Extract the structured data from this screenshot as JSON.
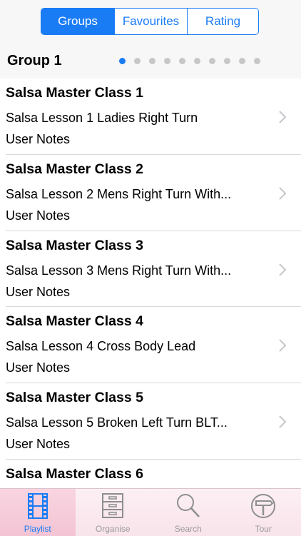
{
  "top_tabs": [
    {
      "label": "Groups",
      "active": true
    },
    {
      "label": "Favourites",
      "active": false
    },
    {
      "label": "Rating",
      "active": false
    }
  ],
  "group": {
    "title": "Group 1",
    "page_count": 10,
    "current_page": 1
  },
  "lessons": [
    {
      "title": "Salsa Master Class 1",
      "subtitle": "Salsa Lesson 1 Ladies Right Turn",
      "notes": "User Notes"
    },
    {
      "title": "Salsa Master Class 2",
      "subtitle": "Salsa Lesson 2 Mens Right Turn With...",
      "notes": "User Notes"
    },
    {
      "title": "Salsa Master Class 3",
      "subtitle": "Salsa Lesson 3 Mens Right Turn With...",
      "notes": "User Notes"
    },
    {
      "title": "Salsa Master Class 4",
      "subtitle": "Salsa Lesson 4 Cross Body Lead",
      "notes": "User Notes"
    },
    {
      "title": "Salsa Master Class 5",
      "subtitle": "Salsa Lesson 5 Broken Left Turn BLT...",
      "notes": "User Notes"
    },
    {
      "title": "Salsa Master Class 6",
      "subtitle": "",
      "notes": ""
    }
  ],
  "tabbar": [
    {
      "label": "Playlist",
      "icon": "film-strip-icon",
      "active": true
    },
    {
      "label": "Organise",
      "icon": "cabinet-icon",
      "active": false
    },
    {
      "label": "Search",
      "icon": "magnifier-icon",
      "active": false
    },
    {
      "label": "Tour",
      "icon": "signpost-icon",
      "active": false
    }
  ],
  "colors": {
    "accent": "#1a7cf5",
    "tabbar_bg": "#f8e3ea",
    "separator": "#d9d9d9"
  }
}
